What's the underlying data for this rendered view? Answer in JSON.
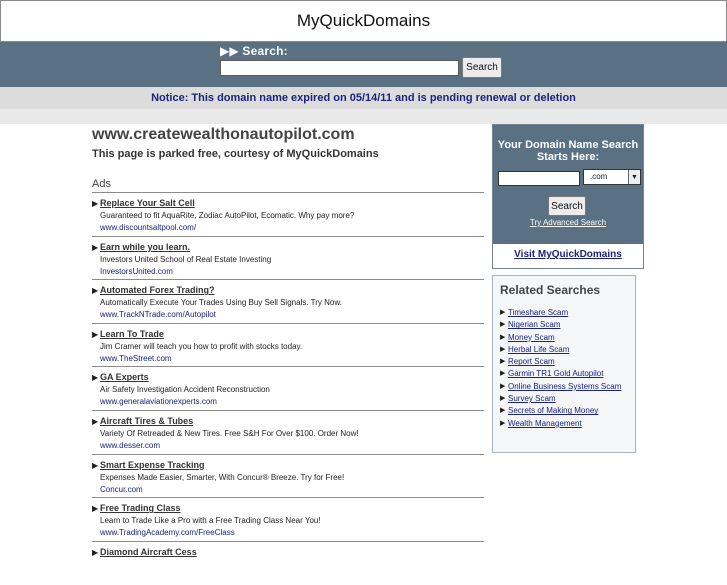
{
  "header": {
    "title": "MyQuickDomains"
  },
  "top_search": {
    "label": "▶▶ Search:",
    "input_value": "",
    "button_label": "Search"
  },
  "notice": {
    "text": "Notice: This domain name expired on 05/14/11 and is pending renewal or deletion"
  },
  "main": {
    "domain": "www.createwealthonautopilot.com",
    "subtitle": "This page is parked free, courtesy of MyQuickDomains",
    "ads_label": "Ads",
    "ads": [
      {
        "title": "Replace Your Salt Cell",
        "desc": "Guaranteed to fit AquaRite, Zodiac AutoPilot, Ecomatic. Why pay more?",
        "url": "www.discountsaltpool.com/"
      },
      {
        "title": "Earn while you learn.",
        "desc": "Investors United School of Real Estate Investing",
        "url": "InvestorsUnited.com"
      },
      {
        "title": "Automated Forex Trading?",
        "desc": "Automatically Execute Your Trades Using Buy Sell Signals. Try Now.",
        "url": "www.TrackNTrade.com/Autopilot"
      },
      {
        "title": "Learn To Trade",
        "desc": "Jim Cramer will teach you how to profit with stocks today.",
        "url": "www.TheStreet.com"
      },
      {
        "title": "GA Experts",
        "desc": "Air Safety Investigation Accident Reconstruction",
        "url": "www.generalaviationexperts.com"
      },
      {
        "title": "Aircraft Tires & Tubes",
        "desc": "Variety Of Retreaded & New Tires. Free S&H For Over $100. Order Now!",
        "url": "www.desser.com"
      },
      {
        "title": "Smart Expense Tracking",
        "desc": "Expenses Made Easier, Smarter, With Concur® Breeze. Try for Free!",
        "url": "Concur.com"
      },
      {
        "title": "Free Trading Class",
        "desc": "Learn to Trade Like a Pro with a Free Trading Class Near You!",
        "url": "www.TradingAcademy.com/FreeClass"
      },
      {
        "title": "Diamond Aircraft Cess",
        "desc": "",
        "url": ""
      }
    ]
  },
  "domain_search": {
    "title": "Your Domain Name Search Starts Here:",
    "input_value": "",
    "tld_selected": ".com",
    "button_label": "Search",
    "advanced_link": "Try Advanced Search"
  },
  "visit_link": "Visit MyQuickDomains",
  "related": {
    "title": "Related Searches",
    "items": [
      "Timeshare Scam",
      "Nigerian Scam",
      "Money Scam",
      "Herbal Life Scam",
      "Report Scam",
      "Garmin TR1 Gold Autopilot",
      "Online Business Systems Scam",
      "Survey Scam",
      "Secrets of Making Money",
      "Wealth Management"
    ]
  },
  "icons": {
    "list_arrow": "▶",
    "dropdown_arrow": "▼"
  }
}
